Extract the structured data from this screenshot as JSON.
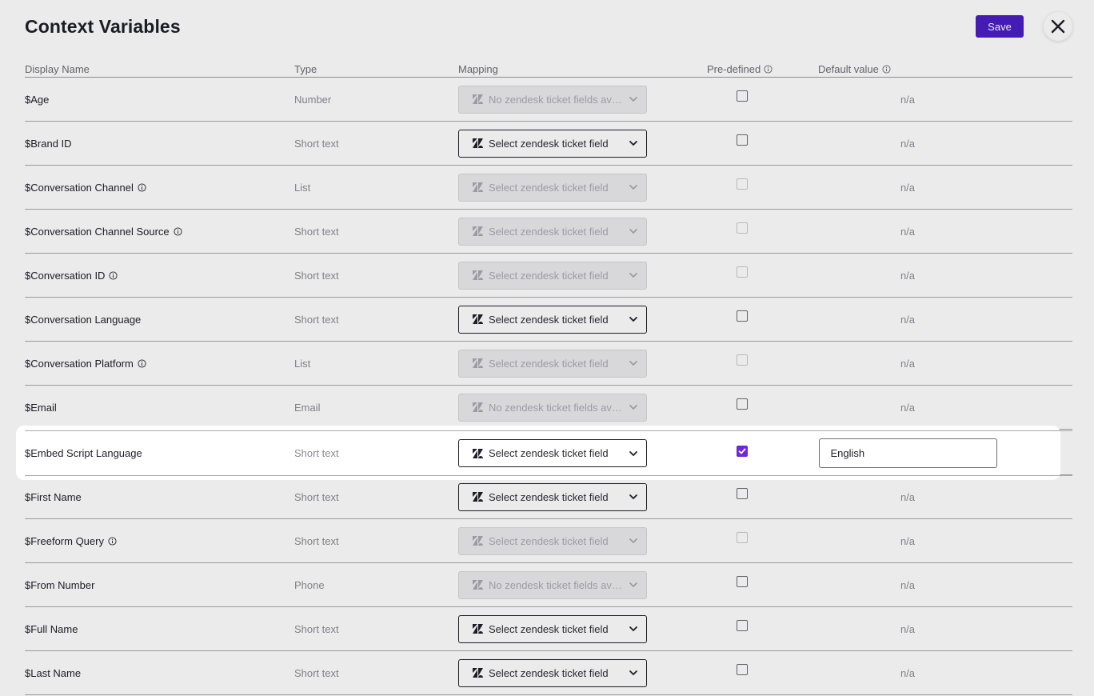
{
  "page": {
    "title": "Context Variables",
    "save_label": "Save"
  },
  "columns": {
    "name": "Display Name",
    "type": "Type",
    "mapping": "Mapping",
    "predefined": "Pre-defined",
    "default": "Default value"
  },
  "colors": {
    "accent": "#4a1fc4",
    "checkbox_checked": "#6d28d9",
    "disabled_select": "#ebebee"
  },
  "rows": [
    {
      "name": "$Age",
      "info": false,
      "type": "Number",
      "mapping": "No zendesk ticket fields ava...",
      "mapping_disabled": true,
      "predefined": false,
      "predefined_disabled": false,
      "default": "n/a"
    },
    {
      "name": "$Brand ID",
      "info": false,
      "type": "Short text",
      "mapping": "Select zendesk ticket field",
      "mapping_disabled": false,
      "predefined": false,
      "predefined_disabled": false,
      "default": "n/a"
    },
    {
      "name": "$Conversation Channel",
      "info": true,
      "type": "List",
      "mapping": "Select zendesk ticket field",
      "mapping_disabled": true,
      "predefined": false,
      "predefined_disabled": true,
      "default": "n/a"
    },
    {
      "name": "$Conversation Channel Source",
      "info": true,
      "type": "Short text",
      "mapping": "Select zendesk ticket field",
      "mapping_disabled": true,
      "predefined": false,
      "predefined_disabled": true,
      "default": "n/a"
    },
    {
      "name": "$Conversation ID",
      "info": true,
      "type": "Short text",
      "mapping": "Select zendesk ticket field",
      "mapping_disabled": true,
      "predefined": false,
      "predefined_disabled": true,
      "default": "n/a"
    },
    {
      "name": "$Conversation Language",
      "info": false,
      "type": "Short text",
      "mapping": "Select zendesk ticket field",
      "mapping_disabled": false,
      "predefined": false,
      "predefined_disabled": false,
      "default": "n/a"
    },
    {
      "name": "$Conversation Platform",
      "info": true,
      "type": "List",
      "mapping": "Select zendesk ticket field",
      "mapping_disabled": true,
      "predefined": false,
      "predefined_disabled": true,
      "default": "n/a"
    },
    {
      "name": "$Email",
      "info": false,
      "type": "Email",
      "mapping": "No zendesk ticket fields ava...",
      "mapping_disabled": true,
      "predefined": false,
      "predefined_disabled": false,
      "default": "n/a"
    },
    {
      "name": "$Embed Script Language",
      "info": false,
      "type": "Short text",
      "mapping": "Select zendesk ticket field",
      "mapping_disabled": false,
      "predefined": true,
      "predefined_disabled": false,
      "default": "English",
      "highlighted": true
    },
    {
      "name": "$First Name",
      "info": false,
      "type": "Short text",
      "mapping": "Select zendesk ticket field",
      "mapping_disabled": false,
      "predefined": false,
      "predefined_disabled": false,
      "default": "n/a"
    },
    {
      "name": "$Freeform Query",
      "info": true,
      "type": "Short text",
      "mapping": "Select zendesk ticket field",
      "mapping_disabled": true,
      "predefined": false,
      "predefined_disabled": true,
      "default": "n/a"
    },
    {
      "name": "$From Number",
      "info": false,
      "type": "Phone",
      "mapping": "No zendesk ticket fields ava...",
      "mapping_disabled": true,
      "predefined": false,
      "predefined_disabled": false,
      "default": "n/a"
    },
    {
      "name": "$Full Name",
      "info": false,
      "type": "Short text",
      "mapping": "Select zendesk ticket field",
      "mapping_disabled": false,
      "predefined": false,
      "predefined_disabled": false,
      "default": "n/a"
    },
    {
      "name": "$Last Name",
      "info": false,
      "type": "Short text",
      "mapping": "Select zendesk ticket field",
      "mapping_disabled": false,
      "predefined": false,
      "predefined_disabled": false,
      "default": "n/a"
    }
  ]
}
